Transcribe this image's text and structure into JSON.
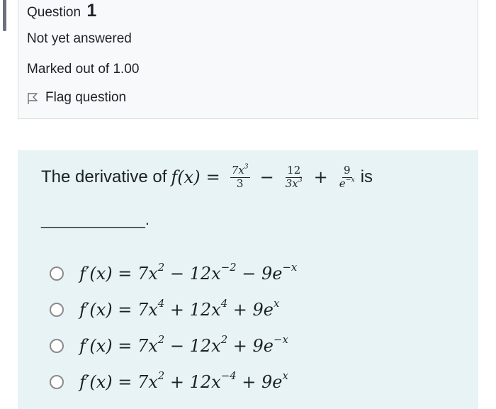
{
  "info": {
    "question_word": "Question",
    "question_number": "1",
    "state": "Not yet answered",
    "grade": "Marked out of 1.00",
    "flag_label": "Flag question"
  },
  "question": {
    "prefix": "The derivative of ",
    "fx": "f(x)",
    "eq": "=",
    "frac1_num_coef": "7x",
    "frac1_num_exp": "3",
    "frac1_den": "3",
    "minus": "−",
    "frac2_num": "12",
    "frac2_den_coef": "3x",
    "frac2_den_exp": "3",
    "plus": "+",
    "frac3_num": "9",
    "frac3_den_base": "e",
    "frac3_den_exp": "−x",
    "suffix": " is",
    "blank": "____________."
  },
  "answers": [
    {
      "lhs": "f′(x) = 7x",
      "e1": "2",
      "mid": " − 12x",
      "e2": "−2",
      "tail": " − 9e",
      "e3": "−x"
    },
    {
      "lhs": "f′(x) = 7x",
      "e1": "4",
      "mid": " + 12x",
      "e2": "4",
      "tail": " + 9e",
      "e3": "x"
    },
    {
      "lhs": "f′(x) = 7x",
      "e1": "2",
      "mid": " − 12x",
      "e2": "2",
      "tail": " + 9e",
      "e3": "−x"
    },
    {
      "lhs": "f′(x) = 7x",
      "e1": "2",
      "mid": " + 12x",
      "e2": "−4",
      "tail": " + 9e",
      "e3": "x"
    }
  ]
}
